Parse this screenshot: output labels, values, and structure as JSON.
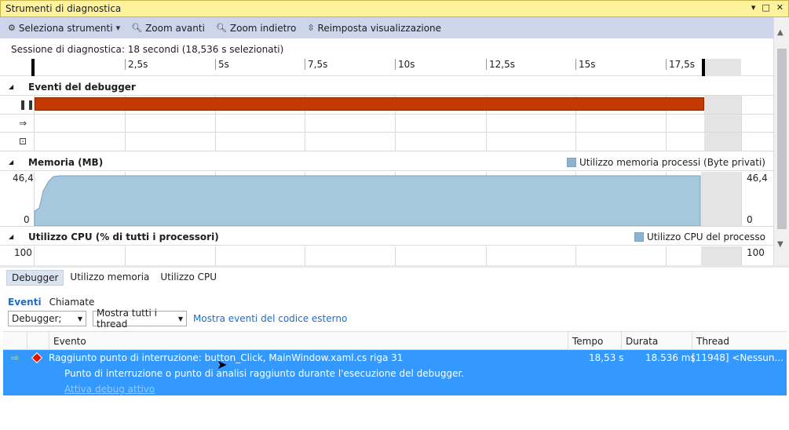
{
  "window": {
    "title": "Strumenti di diagnostica",
    "controls": [
      "▾",
      "□",
      "✕"
    ]
  },
  "toolbar": {
    "select_tools": "Seleziona strumenti",
    "zoom_in": "Zoom avanti",
    "zoom_out": "Zoom indietro",
    "reset_view": "Reimposta visualizzazione"
  },
  "session": {
    "label": "Sessione di diagnostica: 18 secondi (18,536 s selezionati)",
    "ticks": [
      "2,5s",
      "5s",
      "7,5s",
      "10s",
      "12,5s",
      "15s",
      "17,5s"
    ]
  },
  "debugger_events": {
    "title": "Eventi del debugger"
  },
  "memory": {
    "title": "Memoria (MB)",
    "legend": "Utilizzo memoria processi (Byte privati)",
    "ymax": "46,4",
    "ymin": "0",
    "ymax_right": "46,4",
    "ymin_right": "0"
  },
  "cpu": {
    "title": "Utilizzo CPU (% di tutti i processori)",
    "legend": "Utilizzo CPU del processo",
    "ymax": "100",
    "ymax_right": "100"
  },
  "tabs": [
    "Debugger",
    "Utilizzo memoria",
    "Utilizzo CPU"
  ],
  "subtabs": [
    "Eventi",
    "Chiamate"
  ],
  "filters": {
    "category": "Debugger;",
    "thread": "Mostra tutti i thread",
    "external_link": "Mostra eventi del codice esterno"
  },
  "table": {
    "columns": [
      "Evento",
      "Tempo",
      "Durata",
      "Thread"
    ],
    "rows": [
      {
        "event": "Raggiunto punto di interruzione: button_Click, MainWindow.xaml.cs riga 31",
        "detail": "Punto di interruzione o punto di analisi raggiunto durante l'esecuzione del debugger.",
        "link": "Attiva debug attivo",
        "time": "18,53 s",
        "duration": "18.536 ms",
        "thread": "[11948] <Nessun..."
      }
    ]
  }
}
